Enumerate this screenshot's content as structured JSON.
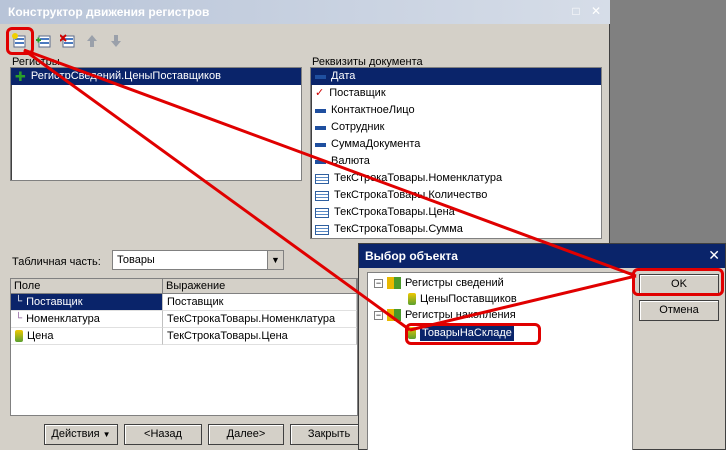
{
  "window": {
    "title": "Конструктор движения регистров",
    "minimize": "□",
    "close": "✕"
  },
  "toolbar": {
    "add_icon": "add-register-icon",
    "edit_icon": "edit-register-icon",
    "delete_icon": "delete-register-icon",
    "up_icon": "move-up-icon",
    "down_icon": "move-down-icon"
  },
  "registers": {
    "header": "Регистры",
    "items": [
      {
        "label": "РегистрСведений.ЦеныПоставщиков"
      }
    ]
  },
  "document_attributes": {
    "header": "Реквизиты документа",
    "items": [
      {
        "label": "Дата",
        "icon": "dash"
      },
      {
        "label": "Поставщик",
        "icon": "check"
      },
      {
        "label": "КонтактноеЛицо",
        "icon": "dash"
      },
      {
        "label": "Сотрудник",
        "icon": "dash"
      },
      {
        "label": "СуммаДокумента",
        "icon": "dash"
      },
      {
        "label": "Валюта",
        "icon": "dash"
      },
      {
        "label": "ТекСтрокаТовары.Номенклатура",
        "icon": "table"
      },
      {
        "label": "ТекСтрокаТовары.Количество",
        "icon": "table"
      },
      {
        "label": "ТекСтрокаТовары.Цена",
        "icon": "table"
      },
      {
        "label": "ТекСтрокаТовары.Сумма",
        "icon": "table"
      }
    ]
  },
  "tabular_part": {
    "label": "Табличная часть:",
    "value": "Товары"
  },
  "mapping_grid": {
    "columns": [
      "Поле",
      "Выражение"
    ],
    "rows": [
      {
        "field": "Поставщик",
        "expression": "Поставщик"
      },
      {
        "field": "Номенклатура",
        "expression": "ТекСтрокаТовары.Номенклатура"
      },
      {
        "field": "Цена",
        "expression": "ТекСтрокаТовары.Цена"
      }
    ]
  },
  "bottom_buttons": {
    "actions": "Действия",
    "back": "<Назад",
    "next": "Далее>",
    "close": "Закрыть"
  },
  "dialog": {
    "title": "Выбор объекта",
    "close": "✕",
    "tree": {
      "group1": "Регистры сведений",
      "group1_child": "ЦеныПоставщиков",
      "group2": "Регистры накопления",
      "group2_child": "ТоварыНаСкладе"
    },
    "ok": "OK",
    "cancel": "Отмена"
  },
  "colors": {
    "highlight": "#e00000",
    "selection": "#0a246a"
  }
}
